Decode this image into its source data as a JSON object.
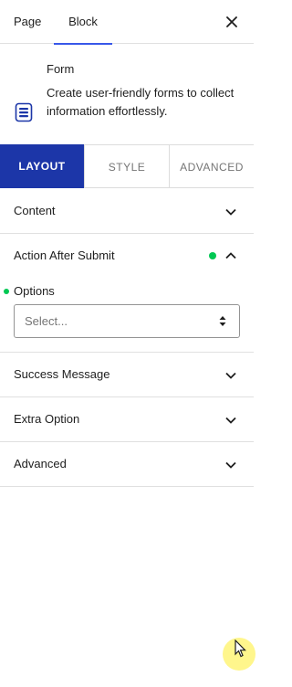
{
  "topbar": {
    "tabs": [
      {
        "label": "Page"
      },
      {
        "label": "Block"
      }
    ],
    "close_icon": "close-icon"
  },
  "block": {
    "title": "Form",
    "description": "Create user-friendly forms to collect information effortlessly.",
    "icon": "form-icon"
  },
  "settings_tabs": [
    {
      "label": "LAYOUT",
      "active": true
    },
    {
      "label": "STYLE"
    },
    {
      "label": "ADVANCED"
    }
  ],
  "panels": {
    "content": {
      "label": "Content"
    },
    "action_after_submit": {
      "label": "Action After Submit",
      "status_color": "#00c853"
    },
    "success_message": {
      "label": "Success Message"
    },
    "extra_option": {
      "label": "Extra Option"
    },
    "advanced": {
      "label": "Advanced"
    }
  },
  "options": {
    "label": "Options",
    "select_value": "Select..."
  },
  "colors": {
    "accent": "#1c36a8",
    "tab_underline": "#3858e9",
    "status_green": "#00c853"
  }
}
